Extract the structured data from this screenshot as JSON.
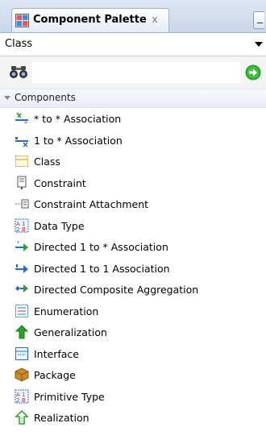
{
  "tab": {
    "title": "Component Palette",
    "close_glyph": "x"
  },
  "dropdown": {
    "value": "Class"
  },
  "search": {
    "value": "",
    "placeholder": ""
  },
  "category": {
    "label": "Components"
  },
  "items": [
    {
      "label": "* to * Association",
      "icon": "many-to-many-association-icon"
    },
    {
      "label": "1 to * Association",
      "icon": "one-to-many-association-icon"
    },
    {
      "label": "Class",
      "icon": "class-icon"
    },
    {
      "label": "Constraint",
      "icon": "constraint-icon"
    },
    {
      "label": "Constraint Attachment",
      "icon": "constraint-attachment-icon"
    },
    {
      "label": "Data Type",
      "icon": "data-type-icon"
    },
    {
      "label": "Directed 1 to * Association",
      "icon": "directed-one-to-many-icon"
    },
    {
      "label": "Directed 1 to 1 Association",
      "icon": "directed-one-to-one-icon"
    },
    {
      "label": "Directed Composite Aggregation",
      "icon": "directed-composite-aggregation-icon"
    },
    {
      "label": "Enumeration",
      "icon": "enumeration-icon"
    },
    {
      "label": "Generalization",
      "icon": "generalization-icon"
    },
    {
      "label": "Interface",
      "icon": "interface-icon"
    },
    {
      "label": "Package",
      "icon": "package-icon"
    },
    {
      "label": "Primitive Type",
      "icon": "primitive-type-icon"
    },
    {
      "label": "Realization",
      "icon": "realization-icon"
    }
  ],
  "colors": {
    "link_blue": "#1f6fd0",
    "accent_green": "#2aa12a",
    "package_tan": "#c98a2b"
  }
}
